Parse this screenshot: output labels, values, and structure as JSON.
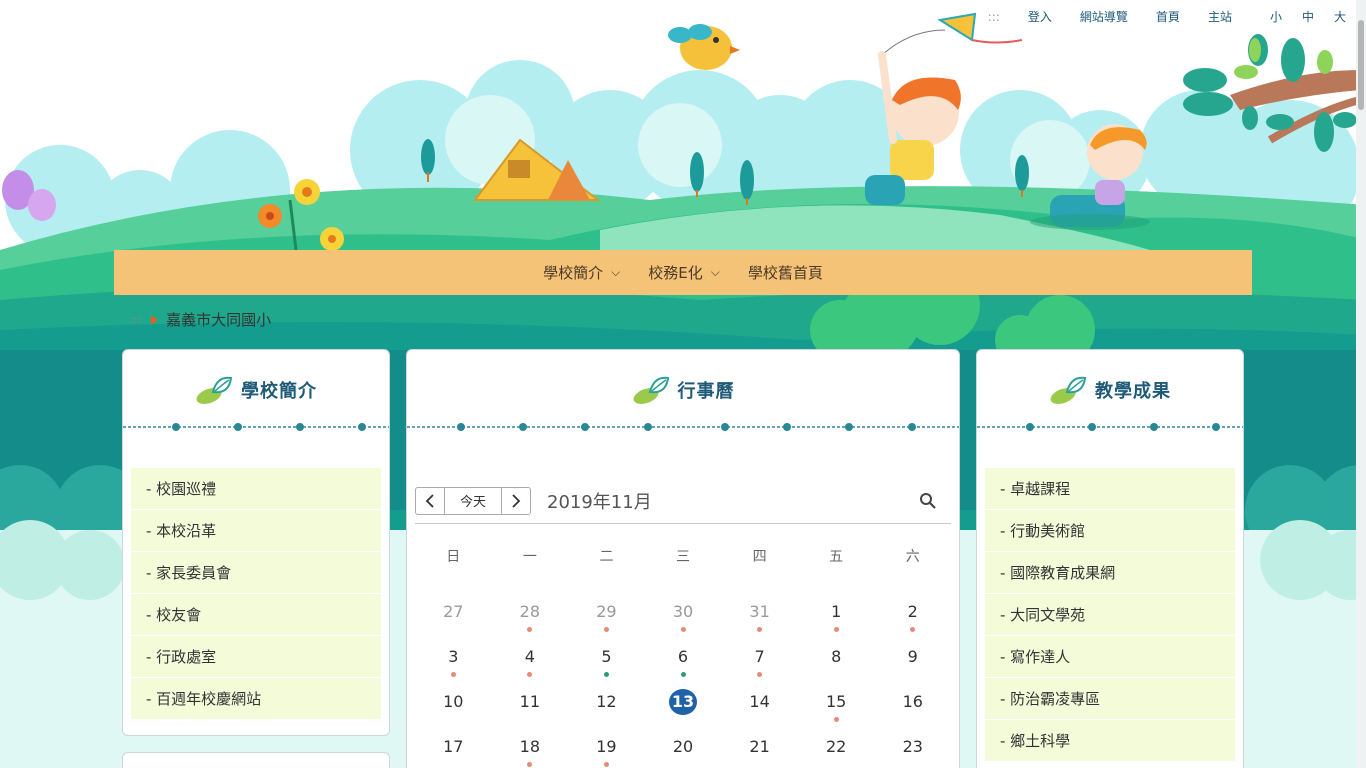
{
  "topbar": {
    "dots": ":::",
    "login": "登入",
    "sitemap": "網站導覽",
    "home": "首頁",
    "mainsite": "主站",
    "font_small": "小",
    "font_medium": "中",
    "font_large": "大"
  },
  "nav": {
    "items": [
      {
        "label": "學校簡介",
        "dropdown": true
      },
      {
        "label": "校務E化",
        "dropdown": true
      },
      {
        "label": "學校舊首頁",
        "dropdown": false
      }
    ]
  },
  "breadcrumb": {
    "dots": ":::",
    "current": "嘉義市大同國小"
  },
  "left_panel": {
    "title": "學校簡介",
    "links": [
      "- 校園巡禮",
      "- 本校沿革",
      "- 家長委員會",
      "- 校友會",
      "- 行政處室",
      "- 百週年校慶網站"
    ]
  },
  "center_panel": {
    "title": "行事曆",
    "today_label": "今天",
    "month_label": "2019年11月",
    "weekdays": [
      "日",
      "一",
      "二",
      "三",
      "四",
      "五",
      "六"
    ],
    "weeks": [
      [
        {
          "d": "27",
          "m": true,
          "dot": ""
        },
        {
          "d": "28",
          "m": true,
          "dot": "red"
        },
        {
          "d": "29",
          "m": true,
          "dot": "red"
        },
        {
          "d": "30",
          "m": true,
          "dot": "red"
        },
        {
          "d": "31",
          "m": true,
          "dot": "red"
        },
        {
          "d": "1",
          "m": false,
          "dot": "red"
        },
        {
          "d": "2",
          "m": false,
          "dot": "red"
        }
      ],
      [
        {
          "d": "3",
          "m": false,
          "dot": "red"
        },
        {
          "d": "4",
          "m": false,
          "dot": "red"
        },
        {
          "d": "5",
          "m": false,
          "dot": "green"
        },
        {
          "d": "6",
          "m": false,
          "dot": "green"
        },
        {
          "d": "7",
          "m": false,
          "dot": "red"
        },
        {
          "d": "8",
          "m": false,
          "dot": ""
        },
        {
          "d": "9",
          "m": false,
          "dot": ""
        }
      ],
      [
        {
          "d": "10",
          "m": false,
          "dot": ""
        },
        {
          "d": "11",
          "m": false,
          "dot": ""
        },
        {
          "d": "12",
          "m": false,
          "dot": ""
        },
        {
          "d": "13",
          "m": false,
          "dot": "",
          "today": true
        },
        {
          "d": "14",
          "m": false,
          "dot": ""
        },
        {
          "d": "15",
          "m": false,
          "dot": "red"
        },
        {
          "d": "16",
          "m": false,
          "dot": ""
        }
      ],
      [
        {
          "d": "17",
          "m": false,
          "dot": ""
        },
        {
          "d": "18",
          "m": false,
          "dot": "red"
        },
        {
          "d": "19",
          "m": false,
          "dot": "red"
        },
        {
          "d": "20",
          "m": false,
          "dot": ""
        },
        {
          "d": "21",
          "m": false,
          "dot": ""
        },
        {
          "d": "22",
          "m": false,
          "dot": ""
        },
        {
          "d": "23",
          "m": false,
          "dot": ""
        }
      ]
    ]
  },
  "right_panel": {
    "title": "教學成果",
    "links": [
      "- 卓越課程",
      "- 行動美術館",
      "- 國際教育成果網",
      "- 大同文學苑",
      "- 寫作達人",
      "- 防治霸凌專區",
      "- 鄉土科學"
    ]
  },
  "colors": {
    "nav_bg": "#f5c378",
    "title_color": "#1f5b78",
    "link_bg": "#f3fbd9",
    "today": "#1f62a8",
    "dot_red": "#e8897a",
    "dot_green": "#2e9c6f"
  }
}
